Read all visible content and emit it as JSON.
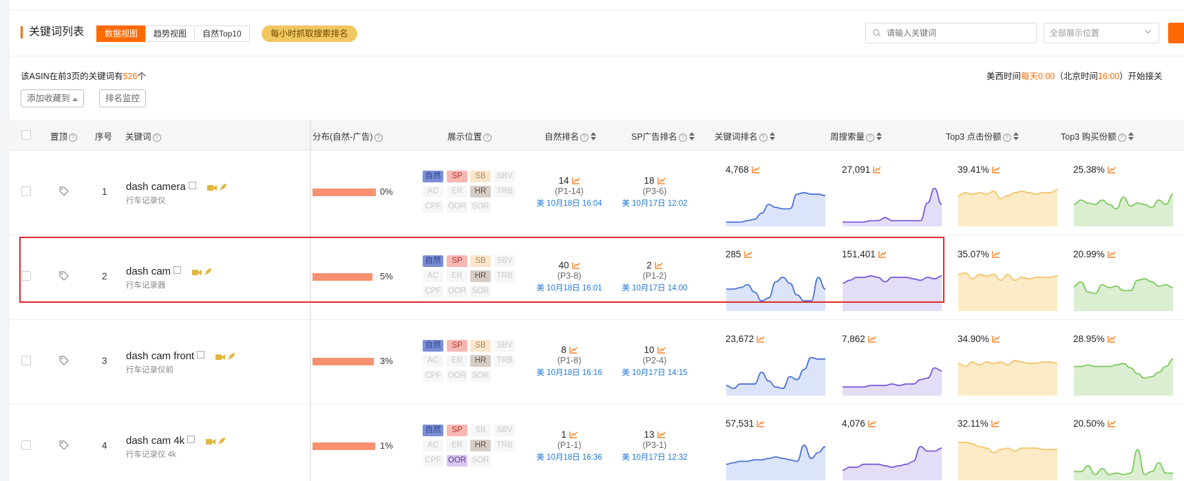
{
  "header": {
    "title": "关键词列表",
    "views": [
      "数据视图",
      "趋势视图",
      "自然Top10"
    ],
    "active_view": 0,
    "hourly_badge": "每小时抓取搜索排名",
    "search_placeholder": "请输入关键词",
    "position_select": "全部展示位置"
  },
  "summary": {
    "prefix": "该ASIN在前3页的关键词有",
    "count": "526",
    "suffix": "个",
    "time_prefix": "美西时间",
    "time_us": "每天0:00",
    "time_mid": "（北京时间",
    "time_bj": "16:00",
    "time_suffix": "）开始接关"
  },
  "actions": {
    "add_favorite": "添加收藏到",
    "rank_monitor": "排名监控"
  },
  "columns": {
    "pin": "置顶",
    "index": "序号",
    "keyword": "关键词",
    "distribution": "分布(自然-广告)",
    "placement": "展示位置",
    "organic_rank": "自然排名",
    "sp_rank": "SP广告排名",
    "keyword_rank": "关键词排名",
    "weekly_search": "周搜索量",
    "top3_click": "Top3 点击份额",
    "top3_purchase": "Top3 购买份额"
  },
  "tag_labels": [
    "自然",
    "SP",
    "SB",
    "SBV",
    "AC",
    "ER",
    "HR",
    "TRB",
    "CPF",
    "OOR",
    "SOR"
  ],
  "colors": {
    "accent": "#ff6a00",
    "tag_natural": "#7b8fd4",
    "tag_sp": "#f7b8b3",
    "tag_sb": "#fbe6cc",
    "tag_hr": "#d6cdc6",
    "tag_oor": "#d9c6f2",
    "spark_rank": "#4a72d6",
    "spark_search": "#7b5ad9",
    "spark_click": "#f5c56a",
    "spark_purchase": "#7dc95e",
    "highlight": "#e3262b"
  },
  "rows": [
    {
      "index": "1",
      "keyword": "dash camera",
      "keyword_cn": "行车记录仪",
      "ad_share": "0%",
      "ad_share_value": 0,
      "tags_on": [
        "自然",
        "SP",
        "SB",
        "HR"
      ],
      "organic_rank": "14",
      "organic_page": "(P1-14)",
      "organic_time": "美 10月18日 16:04",
      "sp_rank": "18",
      "sp_page": "(P3-6)",
      "sp_time": "美 10月17日 12:02",
      "keyword_rank": "4,768",
      "weekly_search": "27,091",
      "top3_click": "39.41%",
      "top3_purchase": "25.38%",
      "trend_rank": [
        2,
        2,
        2,
        3,
        4,
        8,
        14,
        12,
        11,
        11,
        21,
        22,
        21,
        21,
        20
      ],
      "trend_search": [
        2,
        2,
        2,
        2,
        3,
        3,
        5,
        3,
        3,
        3,
        3,
        3,
        15,
        25,
        14
      ],
      "trend_click": [
        20,
        22,
        21,
        22,
        21,
        23,
        18,
        20,
        22,
        23,
        22,
        21,
        22,
        22,
        24
      ],
      "trend_purchase": [
        14,
        17,
        15,
        14,
        17,
        14,
        11,
        19,
        13,
        15,
        14,
        12,
        17,
        14,
        21
      ]
    },
    {
      "index": "2",
      "keyword": "dash cam",
      "keyword_cn": "行车记录器",
      "ad_share": "5%",
      "ad_share_value": 5,
      "tags_on": [
        "自然",
        "SP",
        "SB",
        "HR"
      ],
      "organic_rank": "40",
      "organic_page": "(P3-8)",
      "organic_time": "美 10月18日 16:01",
      "sp_rank": "2",
      "sp_page": "(P1-2)",
      "sp_time": "美 10月17日 14:00",
      "keyword_rank": "285",
      "weekly_search": "151,401",
      "top3_click": "35.07%",
      "top3_purchase": "20.99%",
      "trend_rank": [
        14,
        14,
        15,
        17,
        12,
        6,
        8,
        19,
        22,
        18,
        10,
        6,
        6,
        22,
        14
      ],
      "trend_search": [
        18,
        20,
        22,
        22,
        23,
        22,
        19,
        22,
        22,
        22,
        21,
        20,
        22,
        21,
        23
      ],
      "trend_click": [
        24,
        25,
        21,
        24,
        23,
        24,
        20,
        24,
        20,
        22,
        21,
        22,
        22,
        22,
        23
      ],
      "trend_purchase": [
        16,
        19,
        12,
        11,
        17,
        15,
        16,
        13,
        13,
        20,
        21,
        19,
        16,
        17,
        15
      ]
    },
    {
      "index": "3",
      "keyword": "dash cam front",
      "keyword_cn": "行车记录仪前",
      "ad_share": "3%",
      "ad_share_value": 3,
      "tags_on": [
        "自然",
        "SP",
        "SB",
        "HR"
      ],
      "organic_rank": "8",
      "organic_page": "(P1-8)",
      "organic_time": "美 10月18日 16:16",
      "sp_rank": "10",
      "sp_page": "(P2-4)",
      "sp_time": "美 10月17日 14:15",
      "keyword_rank": "23,672",
      "weekly_search": "7,862",
      "top3_click": "34.90%",
      "top3_purchase": "28.95%",
      "trend_rank": [
        6,
        4,
        7,
        7,
        7,
        15,
        9,
        5,
        4,
        12,
        10,
        17,
        25,
        24,
        24
      ],
      "trend_search": [
        5,
        5,
        5,
        5,
        6,
        6,
        6,
        7,
        6,
        7,
        7,
        10,
        11,
        18,
        16
      ],
      "trend_click": [
        21,
        19,
        22,
        20,
        22,
        21,
        22,
        20,
        23,
        22,
        21,
        21,
        22,
        22,
        21
      ],
      "trend_purchase": [
        19,
        19,
        20,
        19,
        19,
        19,
        20,
        21,
        18,
        14,
        11,
        12,
        15,
        19,
        24
      ]
    },
    {
      "index": "4",
      "keyword": "dash cam 4k",
      "keyword_cn": "行车记录仪 4k",
      "ad_share": "1%",
      "ad_share_value": 1,
      "tags_on": [
        "自然",
        "SP",
        "HR",
        "OOR"
      ],
      "organic_rank": "1",
      "organic_page": "(P1-1)",
      "organic_time": "美 10月18日 16:36",
      "sp_rank": "13",
      "sp_page": "(P3-1)",
      "sp_time": "美 10月17日 12:32",
      "keyword_rank": "57,531",
      "weekly_search": "4,076",
      "top3_click": "32.11%",
      "top3_purchase": "20.50%",
      "trend_rank": [
        10,
        11,
        12,
        12,
        13,
        13,
        14,
        15,
        14,
        13,
        12,
        23,
        14,
        18,
        22
      ],
      "trend_search": [
        6,
        8,
        8,
        10,
        10,
        10,
        9,
        8,
        9,
        10,
        12,
        22,
        19,
        19,
        21
      ],
      "trend_click": [
        25,
        25,
        24,
        22,
        21,
        18,
        20,
        21,
        19,
        21,
        21,
        21,
        20,
        20,
        20
      ],
      "trend_purchase": [
        5,
        5,
        9,
        3,
        7,
        3,
        4,
        3,
        4,
        20,
        3,
        5,
        11,
        4,
        4
      ]
    }
  ]
}
